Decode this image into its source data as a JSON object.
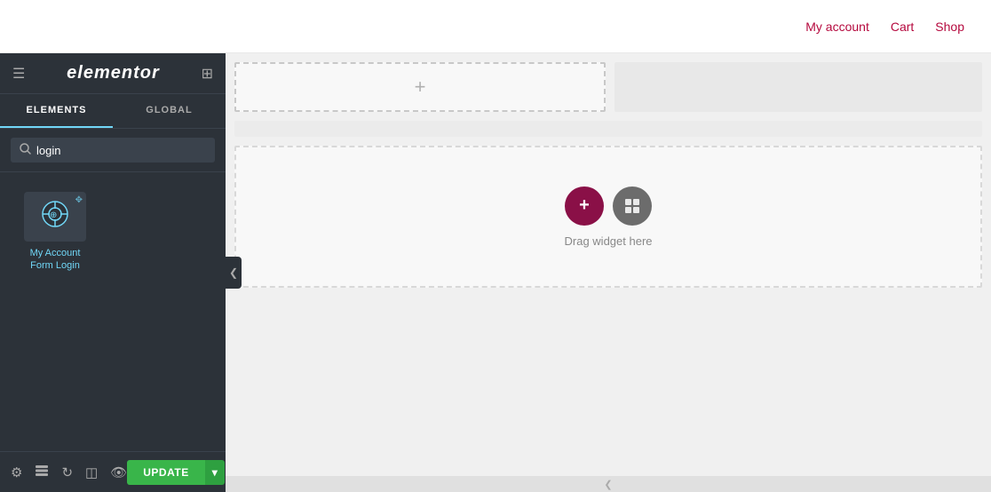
{
  "topbar": {
    "links": [
      {
        "label": "My account",
        "id": "my-account"
      },
      {
        "label": "Cart",
        "id": "cart"
      },
      {
        "label": "Shop",
        "id": "shop"
      }
    ]
  },
  "sidebar": {
    "logo": "elementor",
    "tabs": [
      {
        "label": "ELEMENTS",
        "active": true
      },
      {
        "label": "GLOBAL",
        "active": false
      }
    ],
    "search": {
      "placeholder": "login",
      "value": "login"
    },
    "widgets": [
      {
        "id": "my-account-form-login",
        "label": "My Account Form Login",
        "icon": "⊕"
      }
    ],
    "bottom": {
      "update_label": "UPDATE",
      "arrow_label": "▾"
    }
  },
  "canvas": {
    "sections": [
      {
        "type": "split",
        "id": "section-1"
      },
      {
        "type": "large",
        "id": "section-2"
      }
    ],
    "drag_label": "Drag widget here",
    "add_label": "+",
    "fab_add": "+",
    "fab_grid": "⊞"
  }
}
